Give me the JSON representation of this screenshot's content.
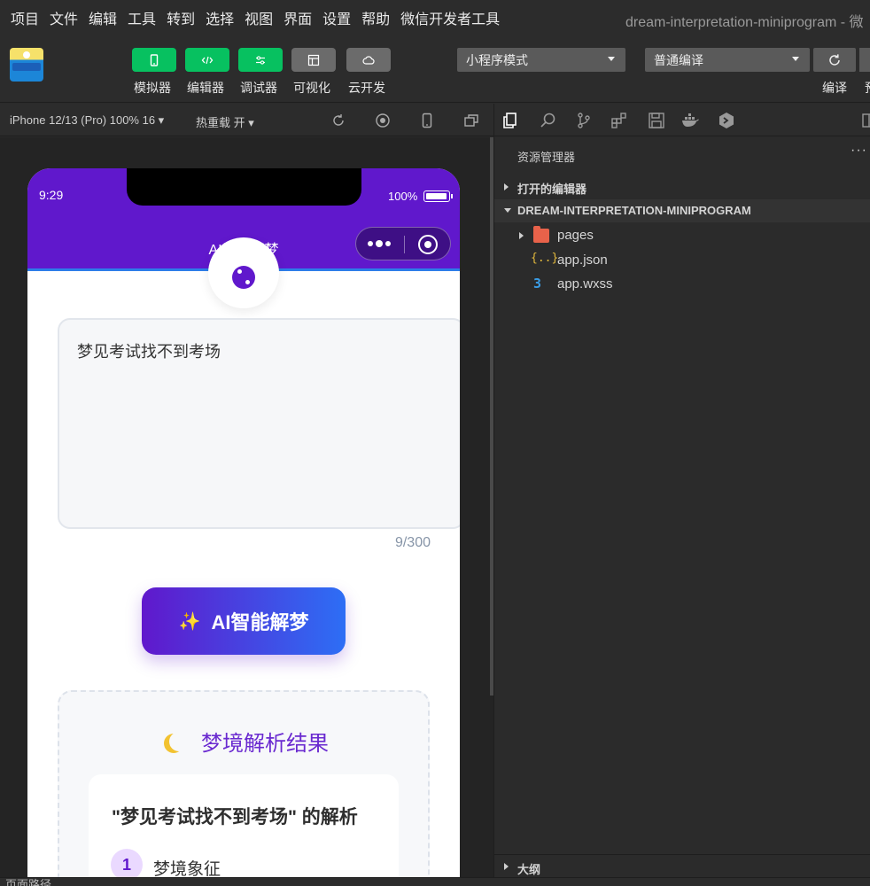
{
  "menu": [
    "项目",
    "文件",
    "编辑",
    "工具",
    "转到",
    "选择",
    "视图",
    "界面",
    "设置",
    "帮助",
    "微信开发者工具"
  ],
  "window_title": "dream-interpretation-miniprogram - 微",
  "toolbar": {
    "buttons": [
      {
        "label": "模拟器",
        "icon": "phone-icon"
      },
      {
        "label": "编辑器",
        "icon": "code-icon"
      },
      {
        "label": "调试器",
        "icon": "debug-icon"
      },
      {
        "label": "可视化",
        "icon": "layout-icon"
      },
      {
        "label": "云开发",
        "icon": "cloud-icon"
      }
    ],
    "mode_select": "小程序模式",
    "compile_select": "普通编译",
    "compile_label": "编译",
    "preview_label": "预"
  },
  "simulator": {
    "device": "iPhone 12/13 (Pro) 100% 16 ▾",
    "hot_reload": "热重载 开 ▾"
  },
  "phone": {
    "time": "9:29",
    "battery": "100%",
    "nav_title": "AI周公解梦",
    "dream_text": "梦见考试找不到考场",
    "char_count": "9/300",
    "ai_button_icon": "✨",
    "ai_button_label": "AI智能解梦",
    "result_title": "梦境解析结果",
    "result_heading": "\"梦见考试找不到考场\" 的解析",
    "section_number": "1",
    "section_label": "梦境象征"
  },
  "explorer": {
    "title": "资源管理器",
    "more": "···",
    "open_editors": "打开的编辑器",
    "project": "DREAM-INTERPRETATION-MINIPROGRAM",
    "files": [
      {
        "name": "pages",
        "type": "folder"
      },
      {
        "name": "app.json",
        "type": "json",
        "icon": "{..}"
      },
      {
        "name": "app.wxss",
        "type": "css",
        "icon": "3"
      }
    ],
    "outline": "大纲"
  },
  "status_bar": {
    "page_path": "页面路径"
  },
  "colors": {
    "brand_green": "#07c160",
    "header_purple": "#6018cc",
    "accent_blue": "#2d6ef5"
  }
}
